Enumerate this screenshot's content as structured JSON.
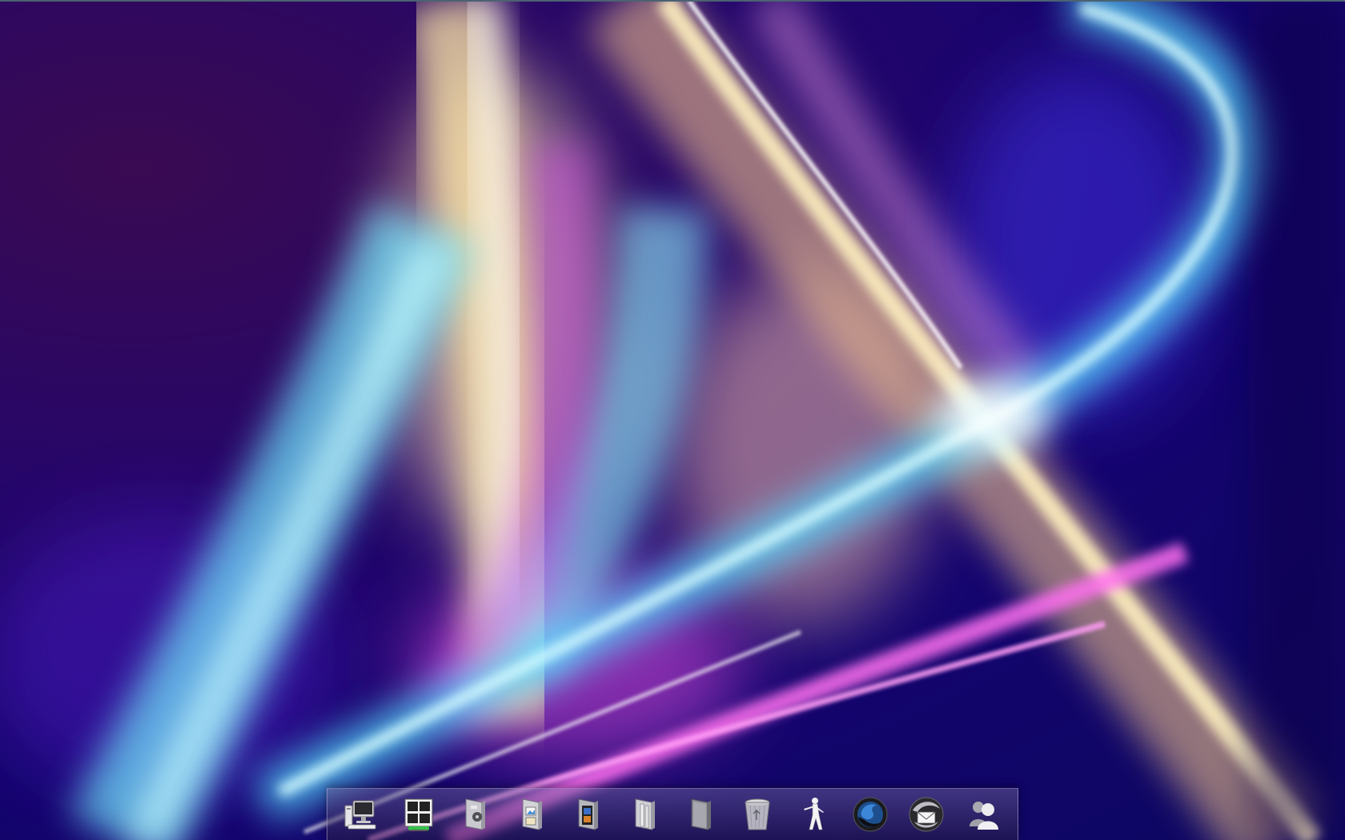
{
  "desktop": {
    "wallpaper": {
      "colors": {
        "base_dark": "#1a0668",
        "cyan": "#7ff4ff",
        "magenta": "#f26cf0",
        "gold": "#ffe49a",
        "white": "#ffffff"
      }
    }
  },
  "dock": {
    "items": [
      {
        "icon": "computer-icon"
      },
      {
        "icon": "control-panel-icon"
      },
      {
        "icon": "music-folder-icon"
      },
      {
        "icon": "pictures-folder-icon"
      },
      {
        "icon": "videos-folder-icon"
      },
      {
        "icon": "documents-folder-icon"
      },
      {
        "icon": "folder-icon"
      },
      {
        "icon": "recycle-bin-icon"
      },
      {
        "icon": "counter-strike-icon"
      },
      {
        "icon": "firefox-icon"
      },
      {
        "icon": "thunderbird-icon"
      },
      {
        "icon": "messenger-icon"
      }
    ]
  }
}
